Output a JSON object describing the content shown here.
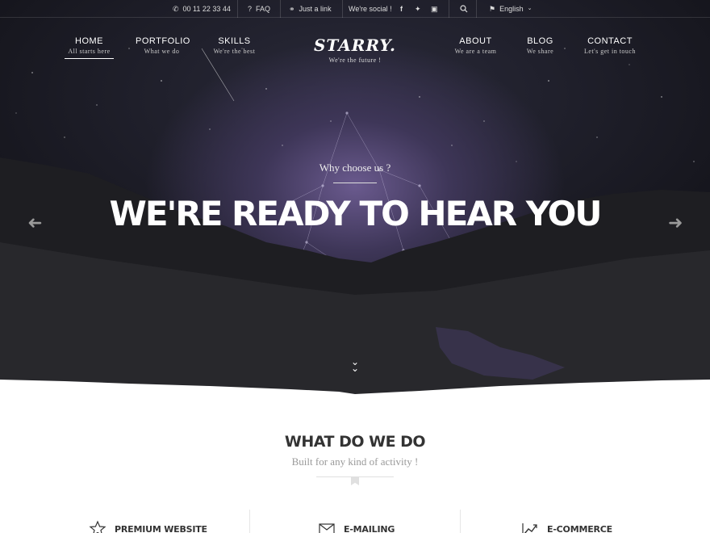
{
  "topbar": {
    "phone": "00 11 22 33 44",
    "faq": "FAQ",
    "link": "Just a link",
    "social_label": "We're social !",
    "language": "English"
  },
  "nav": {
    "left": [
      {
        "title": "HOME",
        "sub": "All starts here"
      },
      {
        "title": "PORTFOLIO",
        "sub": "What we do"
      },
      {
        "title": "SKILLS",
        "sub": "We're the best"
      }
    ],
    "right": [
      {
        "title": "ABOUT",
        "sub": "We are a team"
      },
      {
        "title": "BLOG",
        "sub": "We share"
      },
      {
        "title": "CONTACT",
        "sub": "Let's get in touch"
      }
    ]
  },
  "logo": {
    "text": "STARRY.",
    "tagline": "We're the future !"
  },
  "hero": {
    "kicker": "Why choose us ?",
    "headline": "WE'RE READY TO HEAR YOU"
  },
  "section": {
    "title": "WHAT DO WE DO",
    "subtitle": "Built for any kind of activity !"
  },
  "features": [
    {
      "label": "PREMIUM WEBSITE",
      "icon": "star-icon"
    },
    {
      "label": "E-MAILING",
      "icon": "envelope-icon"
    },
    {
      "label": "E-COMMERCE",
      "icon": "chart-icon"
    }
  ]
}
